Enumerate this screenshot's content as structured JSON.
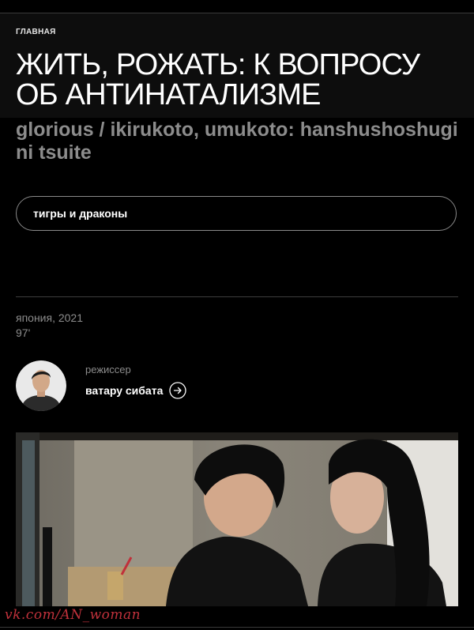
{
  "breadcrumb": {
    "label": "ГЛАВНАЯ"
  },
  "film": {
    "title": "ЖИТЬ, РОЖАТЬ: К ВОПРОСУ ОБ АНТИНАТАЛИЗМЕ",
    "original_title": "glorious / ikirukoto, umukoto: hanshushoshugi ni tsuite",
    "section_tag": "тигры и драконы",
    "country_year": "япония, 2021",
    "duration": "97'"
  },
  "crew": {
    "role": "режиссер",
    "director_name": "ватару сибата",
    "link_icon": "arrow-right-circle-icon"
  },
  "still": {
    "description_icon": "film-still"
  },
  "watermark": {
    "text": "vk.com/AN_woman"
  },
  "colors": {
    "background": "#000000",
    "muted_text": "#8c8c8c",
    "watermark": "#c0313b"
  }
}
